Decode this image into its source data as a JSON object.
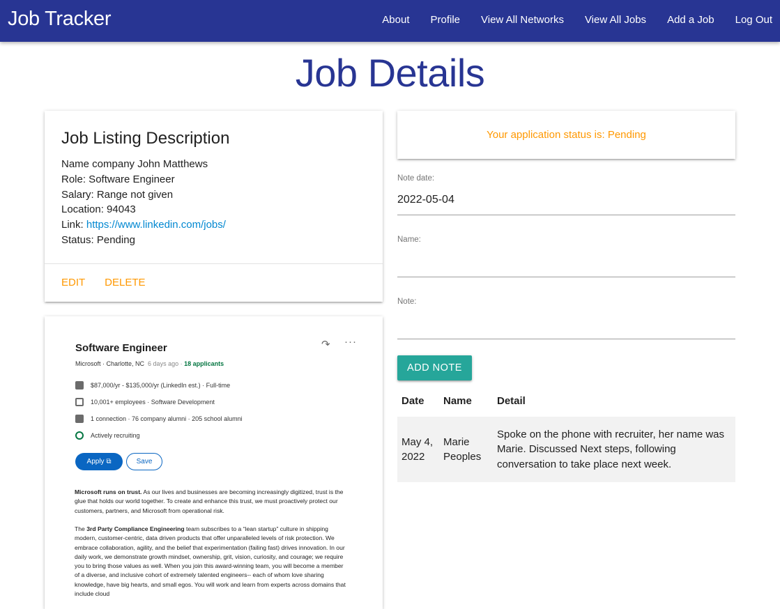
{
  "navbar": {
    "brand": "Job Tracker",
    "links": [
      "About",
      "Profile",
      "View All Networks",
      "View All Jobs",
      "Add a Job",
      "Log Out"
    ]
  },
  "page_title": "Job Details",
  "description_card": {
    "title": "Job Listing Description",
    "name_line": "Name company John Matthews",
    "role_line": "Role: Software Engineer",
    "salary_line": "Salary: Range not given",
    "location_line": "Location: 94043",
    "link_label": "Link: ",
    "link_url": "https://www.linkedin.com/jobs/",
    "status_line": "Status: Pending",
    "actions": {
      "edit": "Edit",
      "delete": "Delete"
    }
  },
  "listing_screenshot": {
    "title": "Software Engineer",
    "share_icon": "↷",
    "more_icon": "···",
    "company_location": "Microsoft · Charlotte, NC",
    "posted": "6 days ago",
    "dot": "·",
    "applicants": "18 applicants",
    "rows": [
      {
        "icon": "briefcase-icon",
        "text": "$87,000/yr - $135,000/yr (LinkedIn est.) · Full-time"
      },
      {
        "icon": "building-icon",
        "text": "10,001+ employees · Software Development"
      },
      {
        "icon": "people-icon",
        "text": "1 connection · 76 company alumni · 205 school alumni"
      },
      {
        "icon": "recruiting-icon",
        "text": "Actively recruiting"
      }
    ],
    "apply_label": "Apply ⧉",
    "save_label": "Save",
    "para1_bold": "Microsoft runs on trust.",
    "para1_rest": " As our lives and businesses are becoming increasingly digitized, trust is the glue that holds our world together. To create and enhance this trust, we must proactively protect our customers, partners, and Microsoft from operational risk.",
    "para2_pre": "The ",
    "para2_bold": "3rd Party Compliance Engineering",
    "para2_rest": " team subscribes to a “lean startup” culture in shipping modern, customer-centric, data driven products that offer unparalleled levels of risk protection. We embrace collaboration, agility, and the belief that experimentation (failing fast) drives innovation. In our daily work, we demonstrate growth mindset, ownership, grit, vision, curiosity, and courage; we require you to bring those values as well. When you join this award-winning team, you will become a member of a diverse, and inclusive cohort of extremely talented engineers-- each of whom love sharing knowledge, have big hearts, and small egos. You will work and learn from experts across domains that include cloud"
  },
  "status_card": {
    "text": "Your application status is: Pending"
  },
  "note_form": {
    "date_label": "Note date:",
    "date_value": "2022-05-04",
    "name_label": "Name:",
    "name_value": "",
    "note_label": "Note:",
    "note_value": "",
    "add_button": "ADD NOTE"
  },
  "notes_table": {
    "headers": [
      "Date",
      "Name",
      "Detail"
    ],
    "rows": [
      {
        "date": "May 4, 2022",
        "name": "Marie Peoples",
        "detail": "Spoke on the phone with recruiter, her name was Marie. Discussed Next steps, following conversation to take place next week."
      }
    ]
  },
  "colors": {
    "primary": "#283593",
    "accent": "#ff9800",
    "teal": "#26a69a",
    "link": "#0288d1"
  }
}
